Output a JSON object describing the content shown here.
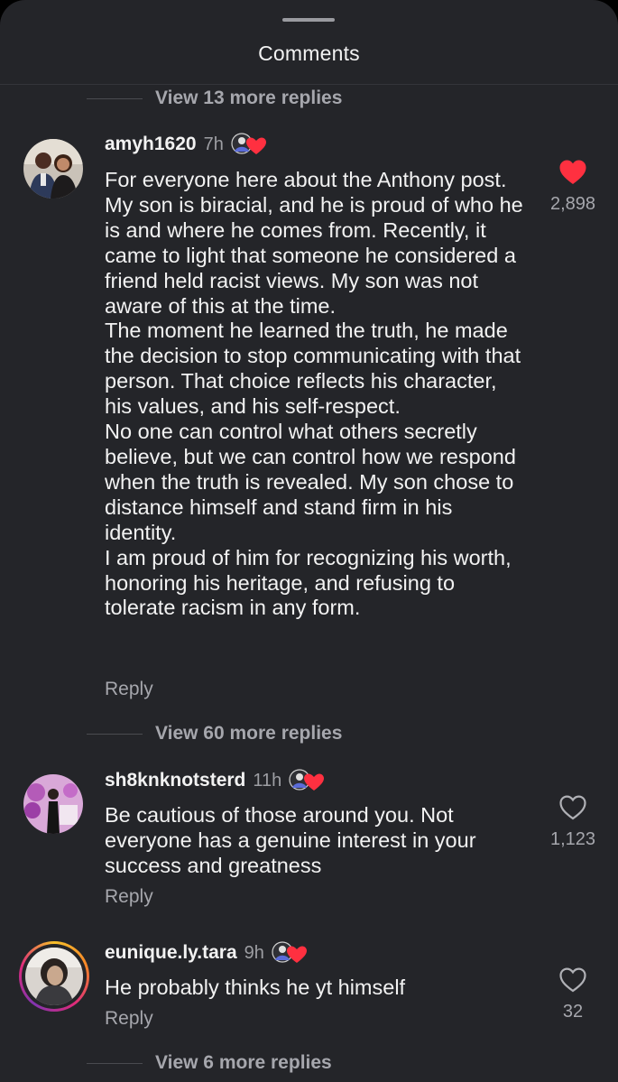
{
  "header": {
    "title": "Comments"
  },
  "threads": {
    "view_more_top": "View 13 more replies",
    "view_more_1": "View 60 more replies",
    "view_more_3": "View 6 more replies"
  },
  "comments": [
    {
      "username": "amyh1620",
      "time": "7h",
      "body": "For everyone here about the Anthony post. My son is biracial, and he is proud of who he is and where he comes from. Recently, it came to light that someone he considered a friend held racist views. My son was not aware of this at the time.\nThe moment he learned the truth, he made the decision to stop communicating with that person. That choice reflects his character, his values, and his self-respect.\nNo one can control what others secretly believe, but we can control how we respond when the truth is revealed. My son chose to distance himself and stand firm in his identity.\nI am proud of him for recognizing his worth, honoring his heritage, and refusing to tolerate racism in any form.",
      "reply_label": "Reply",
      "likes": "2,898",
      "liked": true
    },
    {
      "username": "sh8knknotsterd",
      "time": "11h",
      "body": "Be cautious of those around you. Not everyone has a genuine interest in your success and greatness",
      "reply_label": "Reply",
      "likes": "1,123",
      "liked": false
    },
    {
      "username": "eunique.ly.tara",
      "time": "9h",
      "body": "He probably thinks he yt himself",
      "reply_label": "Reply",
      "likes": "32",
      "liked": false
    }
  ],
  "colors": {
    "sheet_bg": "#242529",
    "like_red": "#ff3040",
    "muted_text": "#a6a7ad"
  },
  "icons": {
    "liked": "heart-filled-icon",
    "unliked": "heart-outline-icon",
    "creator_like": "creator-liked-badge-icon"
  }
}
